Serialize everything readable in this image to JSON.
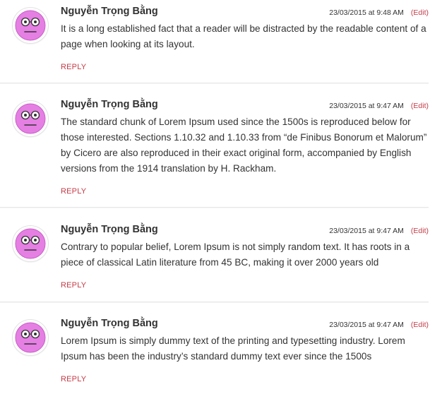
{
  "comments": [
    {
      "author": "Nguyễn Trọng Bằng",
      "timestamp": "23/03/2015 at 9:48 AM",
      "edit_label": "(Edit)",
      "text": "It is a long established fact that a reader will be distracted by the readable content of a page when looking at its layout.",
      "reply_label": "REPLY",
      "avatar_icon": "face-glasses-icon"
    },
    {
      "author": "Nguyễn Trọng Bằng",
      "timestamp": "23/03/2015 at 9:47 AM",
      "edit_label": "(Edit)",
      "text": "The standard chunk of Lorem Ipsum used since the 1500s is reproduced below for those interested. Sections 1.10.32 and 1.10.33 from “de Finibus Bonorum et Malorum” by Cicero are also reproduced in their exact original form, accompanied by English versions from the 1914 translation by H. Rackham.",
      "reply_label": "REPLY",
      "avatar_icon": "face-glasses-icon"
    },
    {
      "author": "Nguyễn Trọng Bằng",
      "timestamp": "23/03/2015 at 9:47 AM",
      "edit_label": "(Edit)",
      "text": "Contrary to popular belief, Lorem Ipsum is not simply random text. It has roots in a piece of classical Latin literature from 45 BC, making it over 2000 years old",
      "reply_label": "REPLY",
      "avatar_icon": "face-glasses-icon"
    },
    {
      "author": "Nguyễn Trọng Bằng",
      "timestamp": "23/03/2015 at 9:47 AM",
      "edit_label": "(Edit)",
      "text": "Lorem Ipsum is simply dummy text of the printing and typesetting industry. Lorem Ipsum has been the industry’s standard dummy text ever since the 1500s",
      "reply_label": "REPLY",
      "avatar_icon": "face-glasses-icon"
    }
  ],
  "colors": {
    "accent": "#c43b47",
    "text": "#333333",
    "avatar_face": "#e57fe3",
    "divider": "#e6e6e6"
  }
}
